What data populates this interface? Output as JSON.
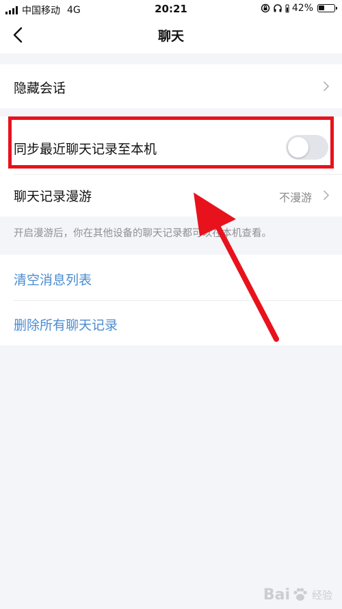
{
  "status_bar": {
    "carrier": "中国移动",
    "network": "4G",
    "time": "20:21",
    "battery": "42%",
    "battery_level": 0.42
  },
  "nav": {
    "title": "聊天"
  },
  "settings": {
    "hide_conversation": "隐藏会话",
    "sync_recent_chats": "同步最近聊天记录至本机",
    "sync_enabled": false,
    "chat_roaming": "聊天记录漫游",
    "chat_roaming_value": "不漫游",
    "roaming_hint": "开启漫游后，你在其他设备的聊天记录都可以在本机查看。",
    "clear_message_list": "清空消息列表",
    "delete_all_records": "删除所有聊天记录"
  },
  "colors": {
    "background": "#f4f5f9",
    "link": "#4a8bd0",
    "annotation_red": "#e8121c",
    "toggle_off": "#e2e4e9"
  },
  "watermark": {
    "brand_prefix": "Bai",
    "brand_suffix": "经验"
  }
}
